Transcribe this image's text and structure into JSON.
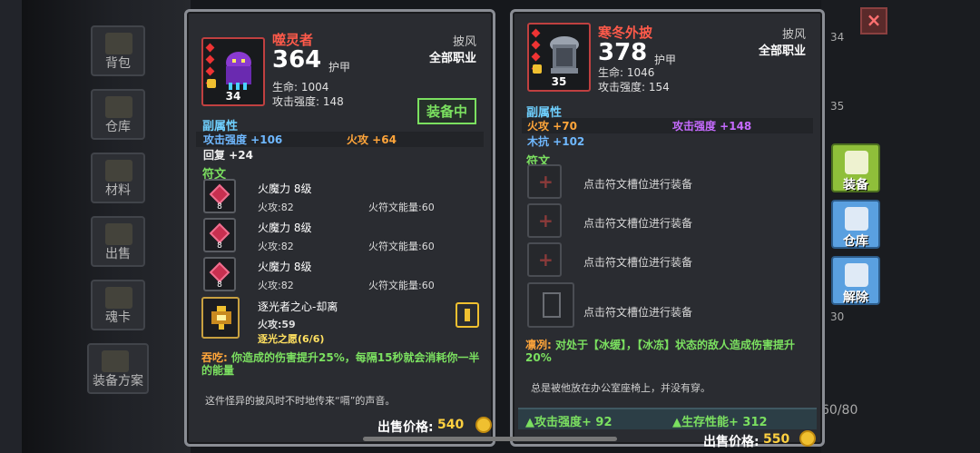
{
  "sidebar": {
    "tabs": [
      {
        "label": "背包"
      },
      {
        "label": "仓库"
      },
      {
        "label": "材料"
      },
      {
        "label": "出售"
      },
      {
        "label": "魂卡"
      },
      {
        "label": "装备方案"
      }
    ]
  },
  "left_item": {
    "name": "噬灵者",
    "armor_value": "364",
    "armor_label": "护甲",
    "hp_line": "生命:  1004",
    "atk_line": "攻击强度:  148",
    "type": "披风",
    "class": "全部职业",
    "level": "34",
    "equipped_label": "装备中",
    "sub_title": "副属性",
    "subs": {
      "a": "攻击强度 +106",
      "b": "火攻 +64",
      "c": "回复 +24"
    },
    "rune_title": "符文",
    "runes": [
      {
        "name": "火魔力 8级",
        "stat1": "火攻:82",
        "stat2": "火符文能量:60",
        "lvl": "8"
      },
      {
        "name": "火魔力 8级",
        "stat1": "火攻:82",
        "stat2": "火符文能量:60",
        "lvl": "8"
      },
      {
        "name": "火魔力 8级",
        "stat1": "火攻:82",
        "stat2": "火符文能量:60",
        "lvl": "8"
      }
    ],
    "special_rune": {
      "name": "逐光者之心-却离",
      "stat": "火攻:59",
      "set": "逐光之愿(6/6)"
    },
    "effect_prefix": "吞吃:",
    "effect_body": "你造成的伤害提升25%，每隔15秒就会消耗你一半的能量",
    "flavor": "这件怪异的披风时不时地传来“嗝”的声音。",
    "price_label": "出售价格:",
    "price": "540"
  },
  "right_item": {
    "name": "寒冬外披",
    "armor_value": "378",
    "armor_label": "护甲",
    "hp_line": "生命:  1046",
    "atk_line": "攻击强度:  154",
    "type": "披风",
    "class": "全部职业",
    "level": "35",
    "sub_title": "副属性",
    "subs": {
      "a": "火攻 +70",
      "b": "攻击强度 +148",
      "c": "木抗 +102"
    },
    "rune_title": "符文",
    "slot_hint": "点击符文槽位进行装备",
    "effect_prefix": "凛冽:",
    "effect_body": "对处于【冰缓】，【冰冻】状态的敌人造成伤害提升20%",
    "flavor": "总是被他放在办公室座椅上，并没有穿。",
    "bonus_atk": "攻击强度+ 92",
    "bonus_surv": "生存性能+ 312",
    "price_label": "出售价格:",
    "price": "550"
  },
  "actions": {
    "equip": "装备",
    "store": "仓库",
    "remove": "解除",
    "close": "×"
  },
  "background_numbers": {
    "n1": "34",
    "n2": "35",
    "n3": "30",
    "n4": "60/80"
  }
}
